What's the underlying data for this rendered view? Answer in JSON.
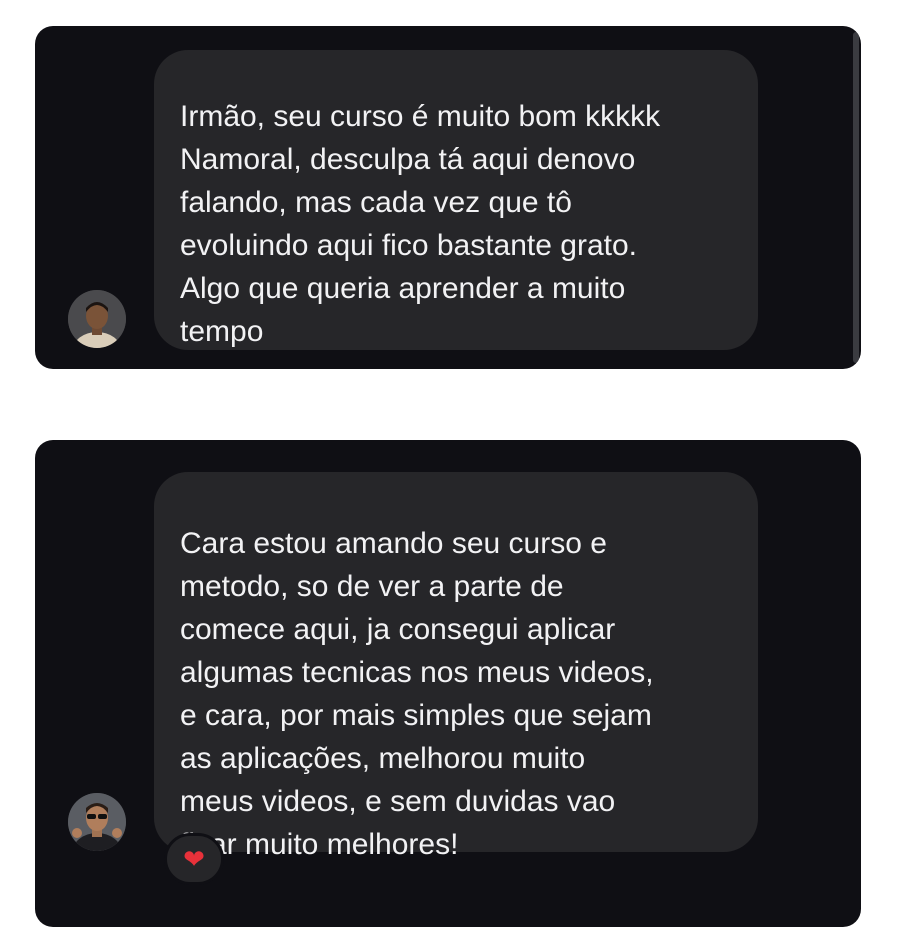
{
  "messages": [
    {
      "lines": [
        "Irmão, seu curso é muito bom kkkkk",
        "Namoral, desculpa tá aqui denovo",
        "falando, mas cada vez que tô",
        "evoluindo aqui fico bastante grato.",
        "Algo que queria aprender a muito",
        "tempo"
      ],
      "avatar_icon": "person-avatar-icon"
    },
    {
      "lines": [
        "Cara estou amando seu curso e",
        "metodo, so de ver a parte de",
        "comece aqui, ja consegui aplicar",
        "algumas tecnicas nos meus videos,",
        "e cara, por mais simples que sejam",
        "as aplicações, melhorou muito",
        "meus videos, e sem duvidas vao",
        "ficar muito melhores!"
      ],
      "avatar_icon": "person-avatar-icon",
      "reaction": "❤"
    }
  ],
  "colors": {
    "card_background": "#0f0f14",
    "bubble_background": "#262629",
    "text": "#f2f2f4",
    "reaction_heart": "#e8313a"
  }
}
